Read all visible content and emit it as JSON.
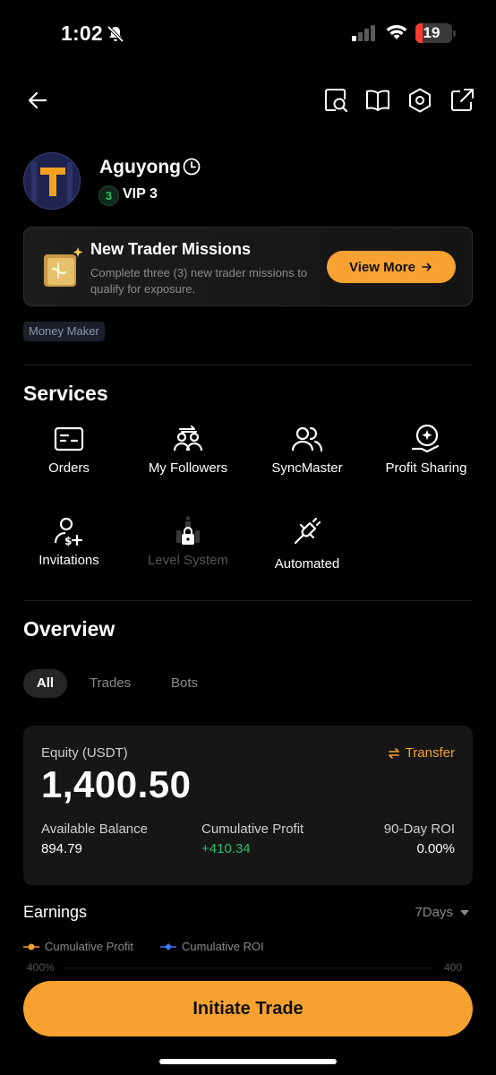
{
  "status_bar": {
    "time": "1:02",
    "battery": "19"
  },
  "profile": {
    "name": "Aguyong",
    "vip_label": "VIP 3",
    "vip_badge_digit": "3"
  },
  "missions": {
    "title": "New Trader Missions",
    "description": "Complete three (3) new trader missions to qualify for exposure.",
    "button_label": "View More"
  },
  "tag": "Money Maker",
  "services": {
    "title": "Services",
    "items": [
      {
        "label": "Orders",
        "icon": "orders-icon"
      },
      {
        "label": "My Followers",
        "icon": "followers-icon"
      },
      {
        "label": "SyncMaster",
        "icon": "users-icon"
      },
      {
        "label": "Profit Sharing",
        "icon": "profit-sharing-icon"
      },
      {
        "label": "Invitations",
        "icon": "invite-icon"
      },
      {
        "label": "Level System",
        "icon": "level-lock-icon"
      },
      {
        "label": "Automated",
        "icon": "plug-icon"
      }
    ]
  },
  "overview": {
    "title": "Overview",
    "tabs": [
      "All",
      "Trades",
      "Bots"
    ],
    "active_tab": "All",
    "equity_label": "Equity (USDT)",
    "transfer_label": "Transfer",
    "equity_value": "1,400.50",
    "stats": [
      {
        "label": "Available Balance",
        "value": "894.79"
      },
      {
        "label": "Cumulative Profit",
        "value": "+410.34"
      },
      {
        "label": "90-Day ROI",
        "value": "0.00%"
      }
    ]
  },
  "earnings": {
    "title": "Earnings",
    "range": "7Days",
    "legend": [
      {
        "label": "Cumulative Profit",
        "color": "#f7a131"
      },
      {
        "label": "Cumulative ROI",
        "color": "#3d7bfa"
      }
    ],
    "axis_left_top": "400%",
    "axis_right_top": "400"
  },
  "cta_label": "Initiate Trade",
  "colors": {
    "accent": "#f7a131",
    "positive": "#2ebd6b",
    "background": "#000000"
  }
}
